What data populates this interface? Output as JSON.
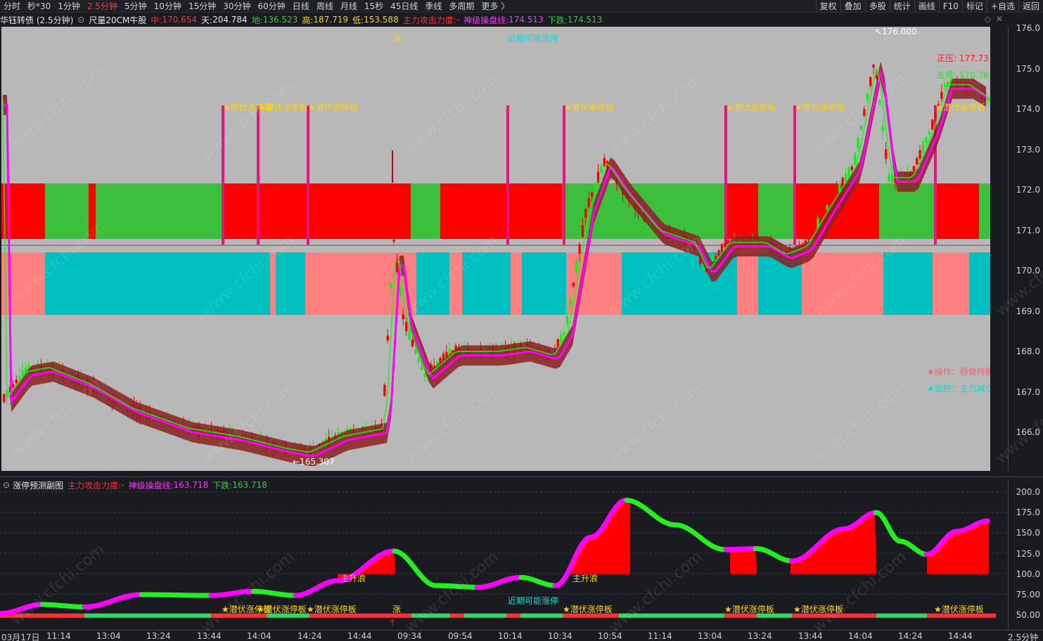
{
  "periods": [
    "分时",
    "秒*30",
    "1分钟",
    "2.5分钟",
    "5分钟",
    "10分钟",
    "15分钟",
    "30分钟",
    "60分钟",
    "日线",
    "周线",
    "月线",
    "15秒",
    "45日线",
    "季线",
    "多周期",
    "更多 〉"
  ],
  "active_period": "2.5分钟",
  "tools": [
    "复权",
    "叠加",
    "多股",
    "统计",
    "画线",
    "F10",
    "标记",
    "+自选",
    "返回"
  ],
  "info": {
    "title": "华钰转债 (2.5分钟)",
    "indicator": "尺量20CM牛股",
    "zhong_label": "中:",
    "zhong": "170.654",
    "tian_label": "天:",
    "tian": "204.784",
    "di_label": "地:",
    "di": "136.523",
    "gao_label": "高:",
    "gao": "187.719",
    "di2_label": "低:",
    "di2": "153.588",
    "force_label": "主力攻击力度:",
    "force": "-",
    "line_label": "神级操盘线:",
    "line": "174.513",
    "down_label": "下跌:",
    "down": "174.513"
  },
  "price_axis": [
    "176.0",
    "175.0",
    "174.0",
    "173.0",
    "172.0",
    "171.0",
    "170.0",
    "169.0",
    "168.0",
    "167.0",
    "166.0"
  ],
  "annotations": {
    "high": "176.000",
    "low": "165.307",
    "zhang": "涨",
    "near": "近期可能涨停",
    "qian": "★潜伏涨停板",
    "zheng": "正压: 177.73",
    "zhi": "支撑: 170.78",
    "op": "★操作：稳健持股",
    "mon": "★监控：主力减仓",
    "up_wave": "主升浪"
  },
  "sub": {
    "title": "涨停预测副图",
    "force_label": "主力攻击力度:",
    "force": "-",
    "line_label": "神级操盘线:",
    "line": "163.718",
    "down_label": "下跌:",
    "down": "163.718",
    "axis": [
      "200.0",
      "175.0",
      "150.0",
      "125.0",
      "100.0",
      "75.00",
      "50.00"
    ]
  },
  "time_axis": [
    "03月17日",
    "11:14",
    "13:04",
    "13:24",
    "13:44",
    "14:04",
    "14:24",
    "14:44",
    "09:34",
    "09:54",
    "10:14",
    "10:34",
    "10:54",
    "11:14",
    "13:04",
    "13:24",
    "13:44",
    "14:04",
    "14:24",
    "14:44",
    "2.5分钟"
  ],
  "watermark": "www.cfchi.com",
  "colors": {
    "up": "#ff0000",
    "down": "#22dd22",
    "magenta": "#ff00ff",
    "cyan": "#00c0c0",
    "pink": "#ff8080",
    "green_band": "#3cbf3c",
    "spike": "#e6157a",
    "brown": "#8b2020"
  }
}
